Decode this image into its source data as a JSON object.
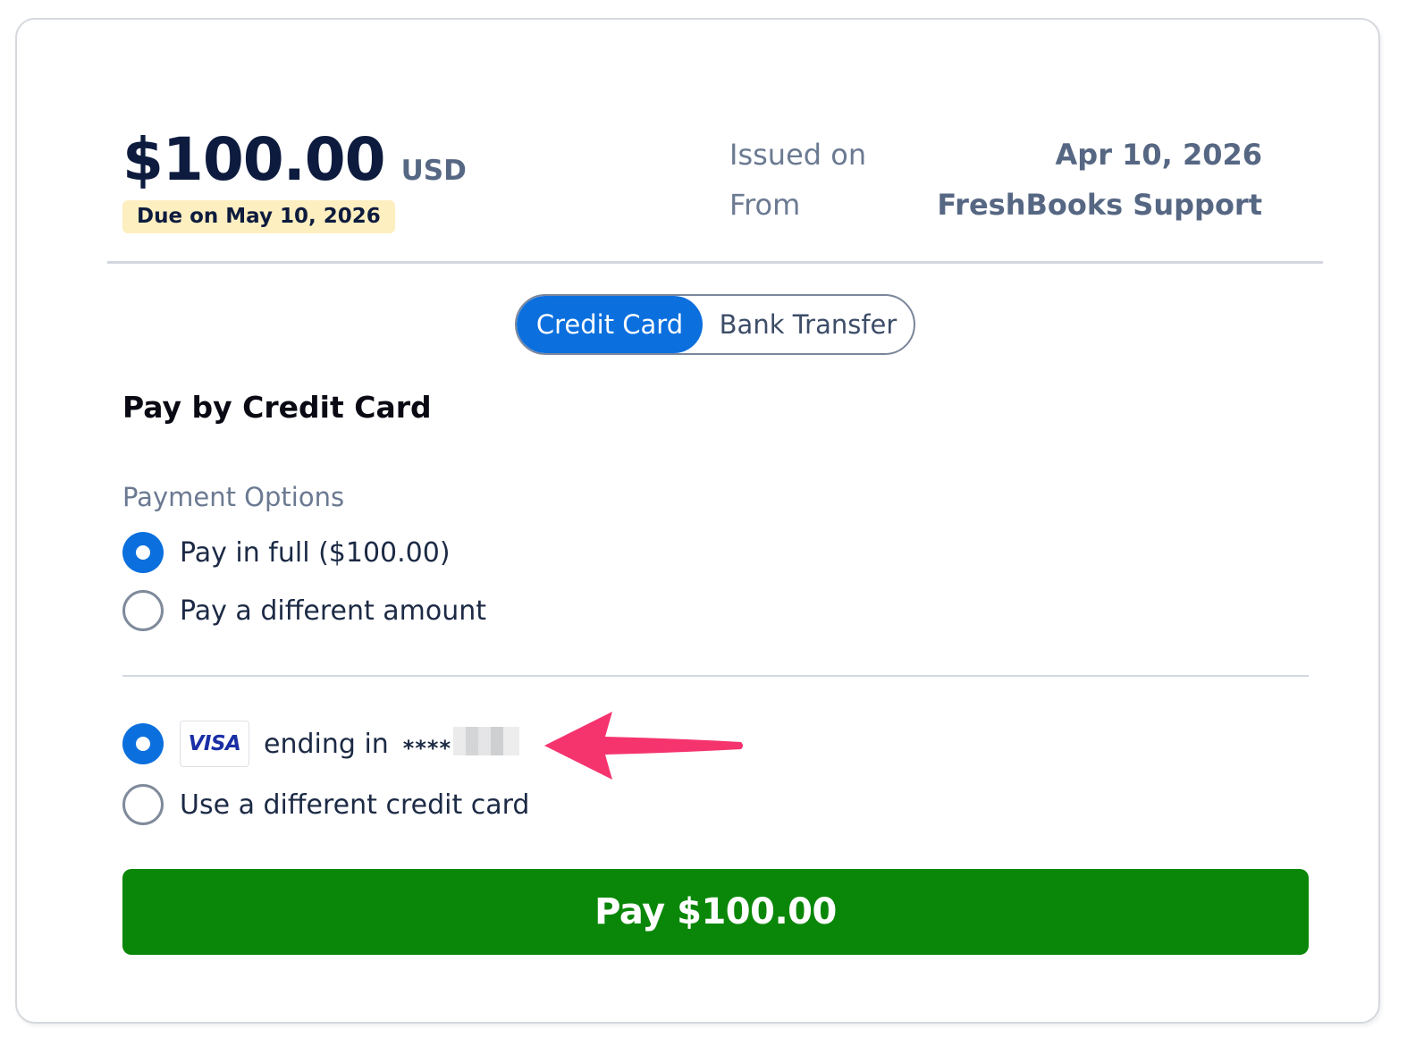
{
  "invoice": {
    "amount": "$100.00",
    "currency": "USD",
    "due_label": "Due on May 10, 2026",
    "issued_label": "Issued on",
    "issued_value": "Apr 10, 2026",
    "from_label": "From",
    "from_value": "FreshBooks Support"
  },
  "payment_method_toggle": {
    "options": [
      {
        "label": "Credit Card",
        "selected": true
      },
      {
        "label": "Bank Transfer",
        "selected": false
      }
    ]
  },
  "section": {
    "title": "Pay by Credit Card",
    "payment_options_label": "Payment Options"
  },
  "payment_options": [
    {
      "label": "Pay in full ($100.00)",
      "selected": true
    },
    {
      "label": "Pay a different amount",
      "selected": false
    }
  ],
  "cards": {
    "saved": {
      "brand": "VISA",
      "ending_label": "ending in",
      "masked_prefix": "****",
      "selected": true
    },
    "other_label": "Use a different credit card",
    "other_selected": false
  },
  "pay_button": {
    "label": "Pay $100.00"
  },
  "colors": {
    "primary_blue": "#0b6fde",
    "pay_green": "#0a8708",
    "due_badge_bg": "#fdefc0",
    "annotation_arrow": "#f5346e"
  },
  "icons": {
    "card_brand": "visa-logo-icon",
    "annotation": "arrow-left-icon"
  }
}
